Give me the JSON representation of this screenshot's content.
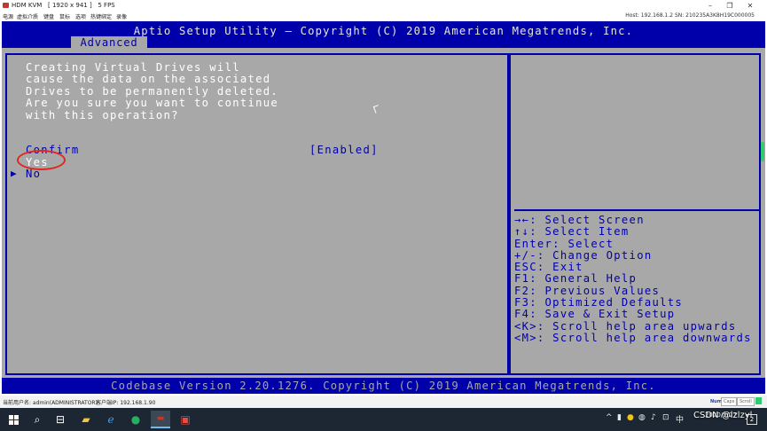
{
  "kvm": {
    "title": "HDM KVM   [ 1920 x 941 ]   5 FPS",
    "menu": [
      "电源",
      "虚拟介质",
      "键盘",
      "鼠标",
      "选项",
      "热键绑定",
      "录像"
    ],
    "host_info": "Host: 192.168.1.2   SN: 210235A3K8H19C000005",
    "status_user": "当前用户名: admin(ADMINISTRATOR)",
    "status_ip": "客户端IP: 192.168.1.90",
    "num_lock": "Num",
    "caps_lock": "Caps",
    "scroll_lock": "Scroll"
  },
  "bios": {
    "title": "Aptio Setup Utility – Copyright (C) 2019 American Megatrends, Inc.",
    "tab": "Advanced",
    "message": "Creating Virtual Drives will\ncause the data on the associated\nDrives to be permanently deleted.\nAre you sure you want to continue\nwith this operation?",
    "confirm_label": "Confirm",
    "confirm_value": "[Enabled]",
    "option_yes": "Yes",
    "option_no": "No",
    "help": [
      "→←: Select Screen",
      "↑↓: Select Item",
      "Enter: Select",
      "+/-: Change Option",
      "ESC: Exit",
      "F1: General Help",
      "F2: Previous Values",
      "F3: Optimized Defaults",
      "F4: Save & Exit Setup",
      "<K>: Scroll help area upwards",
      "<M>: Scroll help area downwards"
    ],
    "footer": "Codebase Version 2.20.1276. Copyright (C) 2019 American Megatrends, Inc."
  },
  "taskbar": {
    "time": "",
    "date": "2020/5/27",
    "tray_text": "中",
    "watermark": "CSDN @lzlzyl"
  },
  "colors": {
    "bios_blue": "#0000aa",
    "bios_gray": "#a8a8a8",
    "highlight_ring": "#e0261d"
  }
}
